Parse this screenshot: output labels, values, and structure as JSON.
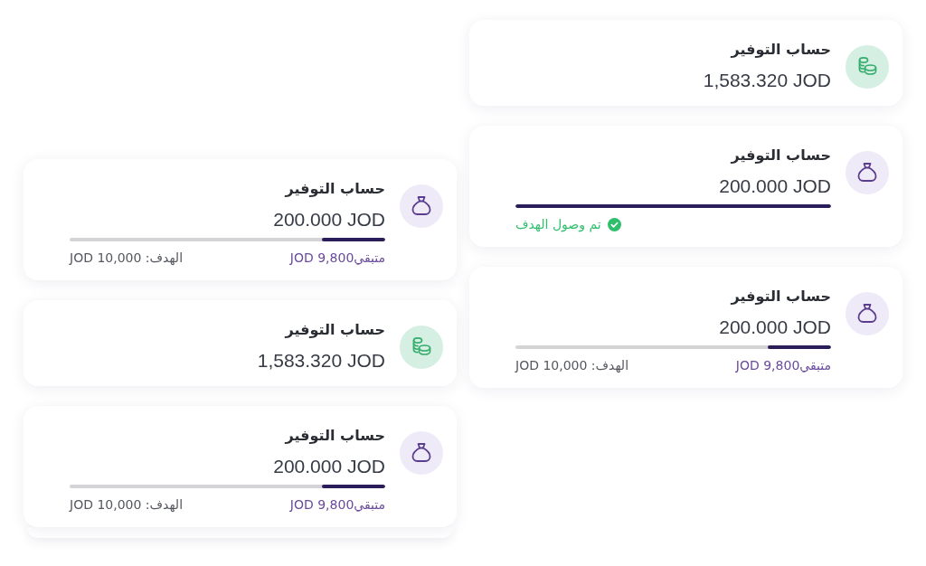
{
  "columns": [
    {
      "cards": [
        {
          "kind": "balance",
          "title": "حساب التوفير",
          "amount": "1,583.320 JOD",
          "stacked": false
        },
        {
          "kind": "reached",
          "title": "حساب التوفير",
          "amount": "200.000 JOD",
          "level": 1,
          "status": "تم وصول الهدف",
          "stacked": false
        },
        {
          "kind": "goal",
          "title": "حساب التوفير",
          "amount": "200.000 JOD",
          "level": 0.2,
          "remaining": "متبقي9,800 JOD",
          "target": "الهدف: 10,000 JOD",
          "stacked": false
        }
      ]
    },
    {
      "cards": [
        {
          "kind": "goal",
          "title": "حساب التوفير",
          "amount": "200.000 JOD",
          "level": 0.2,
          "remaining": "متبقي9,800 JOD",
          "target": "الهدف: 10,000 JOD",
          "stacked": false
        },
        {
          "kind": "balance",
          "title": "حساب التوفير",
          "amount": "1,583.320 JOD",
          "stacked": false
        },
        {
          "kind": "goal",
          "title": "حساب التوفير",
          "amount": "200.000 JOD",
          "level": 0.2,
          "remaining": "متبقي9,800 JOD",
          "target": "الهدف: 10,000 JOD",
          "stacked": true
        }
      ]
    }
  ]
}
